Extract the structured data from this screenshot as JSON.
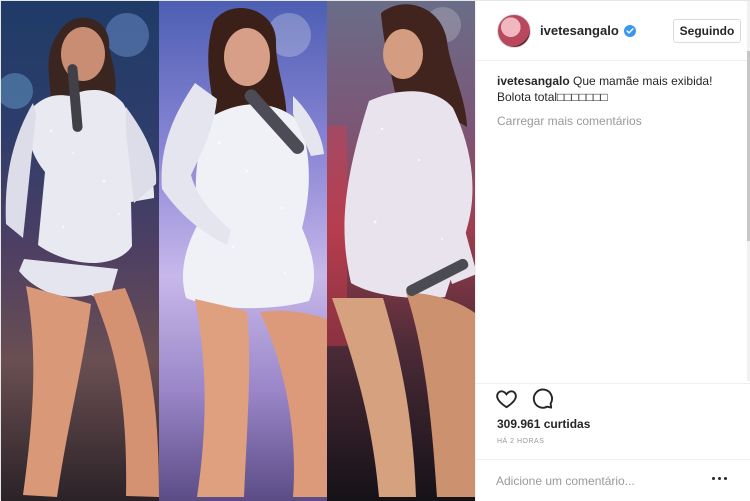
{
  "post": {
    "username": "ivetesangalo",
    "follow_label": "Seguindo",
    "caption_user": "ivetesangalo",
    "caption_text": "Que mamãe mais exibida! Bolota total□□□□□□□",
    "load_more": "Carregar mais comentários",
    "likes": "309.961 curtidas",
    "time": "HÁ 2 HORAS",
    "comment_placeholder": "Adicione um comentário..."
  },
  "icons": {
    "verified": "verified-badge",
    "like": "heart-icon",
    "comment": "comment-icon",
    "options": "more-options-icon"
  },
  "colors": {
    "accent": "#3897f0",
    "muted": "#999999",
    "border": "#efefef",
    "dress": "#e9e9f2"
  }
}
